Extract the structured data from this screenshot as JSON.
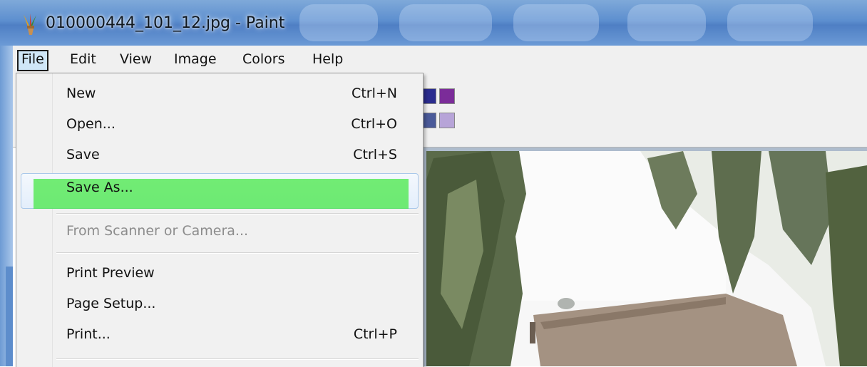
{
  "window": {
    "title": "010000444_101_12.jpg - Paint",
    "app_icon": "paint-icon"
  },
  "menubar": {
    "items": [
      {
        "label": "File",
        "active": true
      },
      {
        "label": "Edit"
      },
      {
        "label": "View"
      },
      {
        "label": "Image"
      },
      {
        "label": "Colors"
      },
      {
        "label": "Help"
      }
    ]
  },
  "file_menu": {
    "items": [
      {
        "label": "New",
        "shortcut": "Ctrl+N"
      },
      {
        "label": "Open...",
        "shortcut": "Ctrl+O"
      },
      {
        "label": "Save",
        "shortcut": "Ctrl+S"
      },
      {
        "label": "Save As...",
        "shortcut": "",
        "highlighted": true
      },
      {
        "label": "From Scanner or Camera...",
        "shortcut": "",
        "disabled": true
      },
      {
        "label": "Print Preview",
        "shortcut": ""
      },
      {
        "label": "Page Setup...",
        "shortcut": ""
      },
      {
        "label": "Print...",
        "shortcut": "Ctrl+P"
      }
    ]
  },
  "palette": {
    "colors": [
      "#2a2c8e",
      "#7b2c99",
      "#4a5a99",
      "#b7a4d8"
    ]
  },
  "colors": {
    "highlight": "#40e840",
    "menu_bg": "#f1f1f1",
    "title_bar": "#5d8fcf"
  }
}
